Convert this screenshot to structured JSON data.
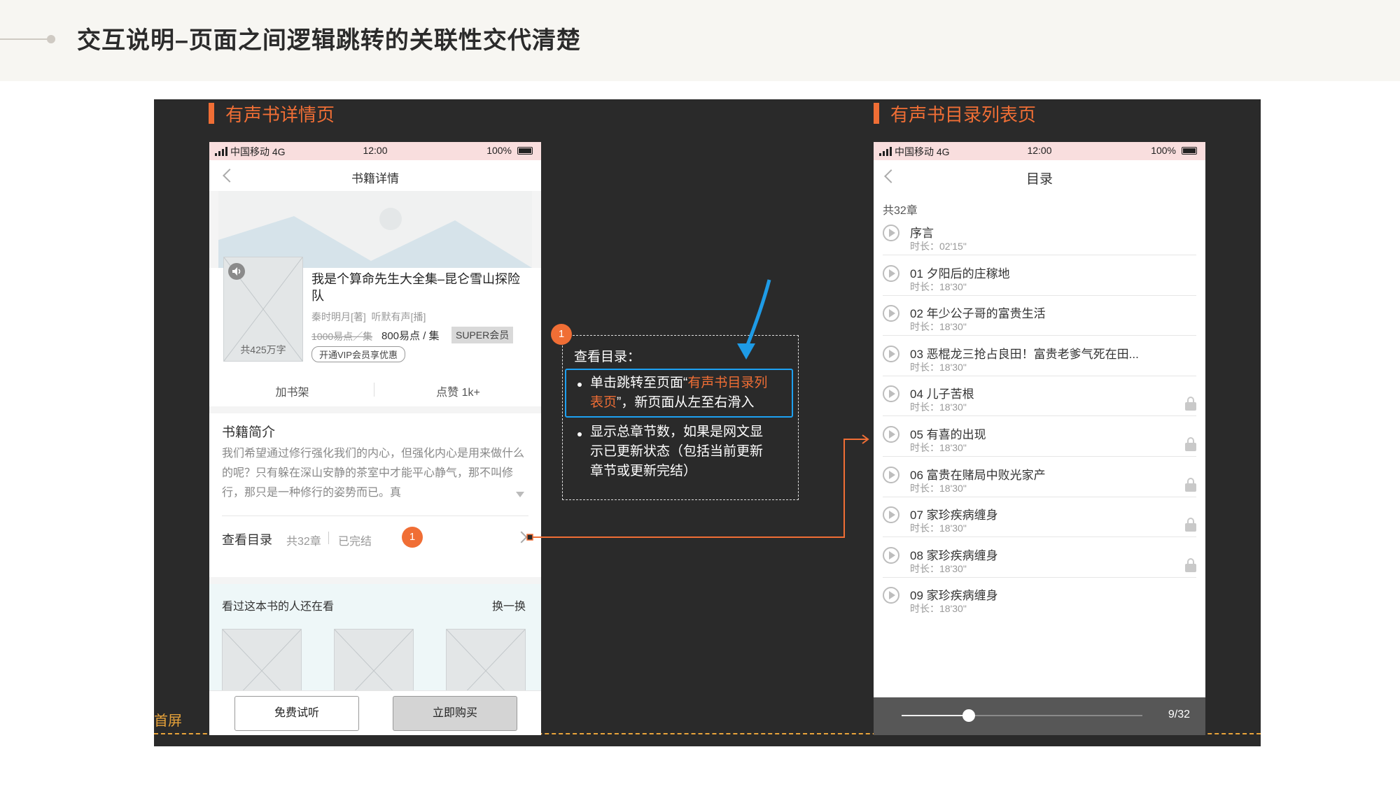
{
  "page_title": "交互说明–页面之间逻辑跳转的关联性交代清楚",
  "left_section": {
    "title": "有声书详情页"
  },
  "right_section": {
    "title": "有声书目录列表页"
  },
  "fold_label": "首屏",
  "status_bar": {
    "carrier": "中国移动",
    "network": "4G",
    "time": "12:00",
    "battery": "100%"
  },
  "detail": {
    "nav_title": "书籍详情",
    "book_title": "我是个算命先生大全集–昆仑雪山探险队",
    "authors": "秦时明月[著]  听默有声[播]",
    "price_original": "1000易点／集",
    "price_current": "800易点 / 集",
    "member_tag": "SUPER会员",
    "vip_button": "开通VIP会员享优惠",
    "word_count": "共425万字",
    "add_shelf": "加书架",
    "likes": "点赞 1k+",
    "intro_heading": "书籍简介",
    "intro_text": "我们希望通过修行强化我们的内心，但强化内心是用来做什么的呢？只有躲在深山安静的茶室中才能平心静气，那不叫修行，那只是一种修行的姿势而已。真",
    "catalog_label": "查看目录",
    "catalog_count": "共32章",
    "catalog_status": "已完结",
    "badge": "1",
    "related_heading": "看过这本书的人还在看",
    "related_refresh": "换一换",
    "btn_trial": "免费试听",
    "btn_buy": "立即购买"
  },
  "annotation": {
    "badge": "1",
    "heading": "查看目录：",
    "item1_a": "单击跳转至页面“",
    "item1_highlight_a": "有声书目录列",
    "item1_highlight_b": "表页",
    "item1_b": "”，新页面从左至右滑入",
    "item2_line1": "显示总章节数，如果是网文显",
    "item2_line2": "示已更新状态（包括当前更新",
    "item2_line3": "章节或更新完结）",
    "colors": {
      "highlight": "#f06e35",
      "box": "#1da1f2",
      "arrow": "#1e9be6"
    }
  },
  "catalog": {
    "nav_title": "目录",
    "total": "共32章",
    "duration_label": "时长：",
    "chapters": [
      {
        "title": "序言",
        "duration": "02'15\"",
        "locked": false
      },
      {
        "title": "01 夕阳后的庄稼地",
        "duration": "18'30\"",
        "locked": false
      },
      {
        "title": "02 年少公子哥的富贵生活",
        "duration": "18'30\"",
        "locked": false
      },
      {
        "title": "03 恶棍龙三抢占良田！富贵老爹气死在田...",
        "duration": "18'30\"",
        "locked": false
      },
      {
        "title": "04 儿子苦根",
        "duration": "18'30\"",
        "locked": true
      },
      {
        "title": "05 有喜的出现",
        "duration": "18'30\"",
        "locked": true
      },
      {
        "title": "06 富贵在赌局中败光家产",
        "duration": "18'30\"",
        "locked": true
      },
      {
        "title": "07 家珍疾病缠身",
        "duration": "18'30\"",
        "locked": true
      },
      {
        "title": "08 家珍疾病缠身",
        "duration": "18'30\"",
        "locked": true
      },
      {
        "title": "09 家珍疾病缠身",
        "duration": "18'30\"",
        "locked": false
      }
    ],
    "progress_label": "9/32",
    "progress_value": 0.28
  }
}
